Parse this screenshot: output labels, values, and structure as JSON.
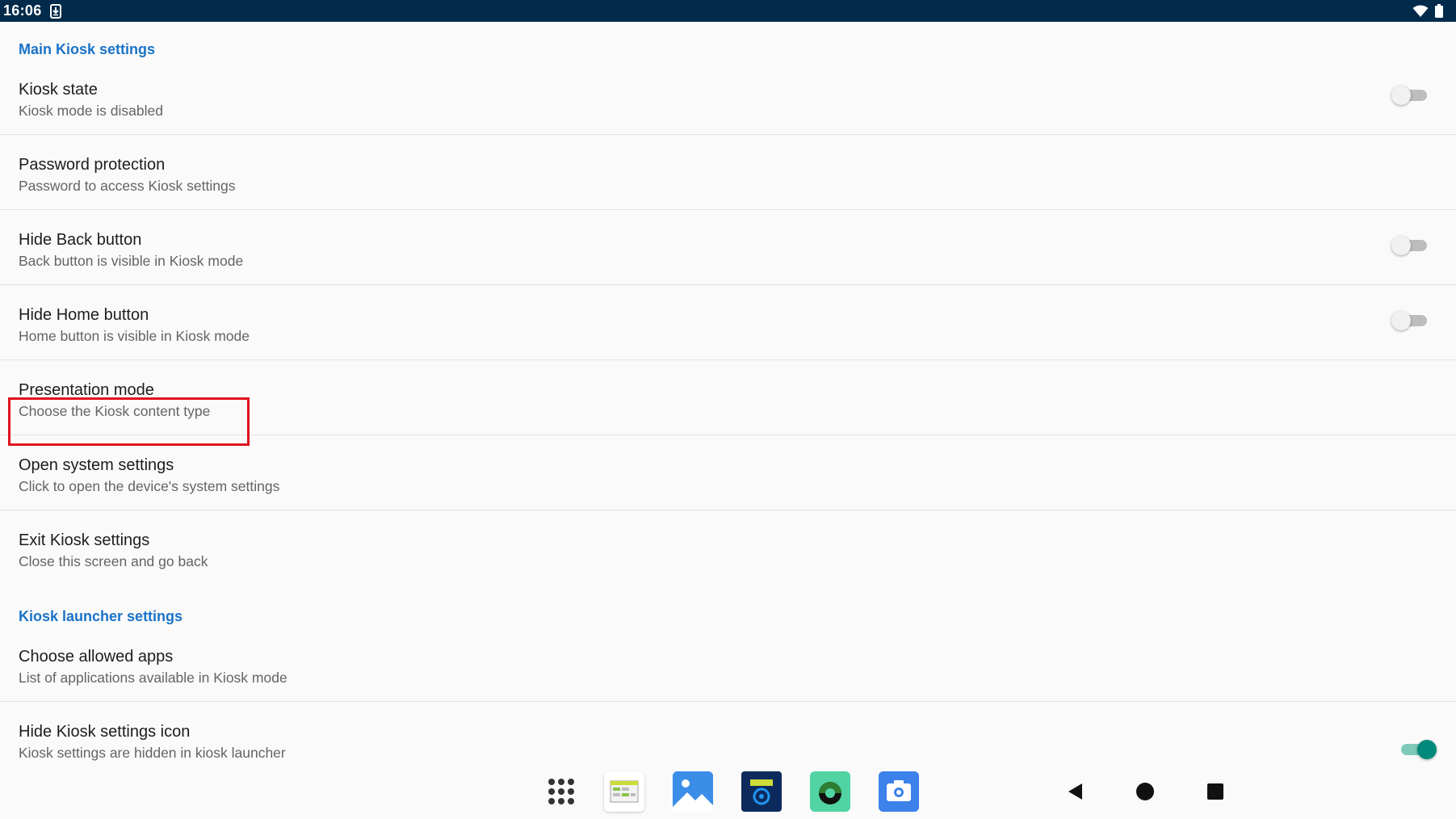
{
  "status_bar": {
    "time": "16:06",
    "left_icons": [
      "download-notification-icon"
    ],
    "right_icons": [
      "wifi-icon",
      "battery-icon"
    ]
  },
  "sections": {
    "main_header": "Main Kiosk settings",
    "launcher_header": "Kiosk launcher settings"
  },
  "settings": {
    "kiosk_state": {
      "title": "Kiosk state",
      "subtitle": "Kiosk mode is disabled",
      "toggle_on": false
    },
    "password_protection": {
      "title": "Password protection",
      "subtitle": "Password to access Kiosk settings"
    },
    "hide_back_button": {
      "title": "Hide Back button",
      "subtitle": "Back button is visible in Kiosk mode",
      "toggle_on": false
    },
    "hide_home_button": {
      "title": "Hide Home button",
      "subtitle": "Home button is visible in Kiosk mode",
      "toggle_on": false
    },
    "presentation_mode": {
      "title": "Presentation mode",
      "subtitle": "Choose the Kiosk content type"
    },
    "open_system_settings": {
      "title": "Open system settings",
      "subtitle": "Click to open the device's system settings"
    },
    "exit_kiosk_settings": {
      "title": "Exit Kiosk settings",
      "subtitle": "Close this screen and go back"
    },
    "choose_allowed_apps": {
      "title": "Choose allowed apps",
      "subtitle": "List of applications available in Kiosk mode"
    },
    "hide_kiosk_settings_icon": {
      "title": "Hide Kiosk settings icon",
      "subtitle": "Kiosk settings are hidden in kiosk launcher",
      "toggle_on": true
    }
  },
  "dock": {
    "apps": [
      "app-drawer-icon",
      "sheets-app-icon",
      "gallery-app-icon",
      "webcam-app-icon",
      "browser-app-icon",
      "camera-app-icon"
    ],
    "nav": [
      "back-icon",
      "home-icon",
      "recents-icon"
    ]
  },
  "colors": {
    "status_bar": "#022a4a",
    "section_header": "#1a73c8",
    "toggle_on": "#00897b",
    "highlight": "#e0121f"
  }
}
